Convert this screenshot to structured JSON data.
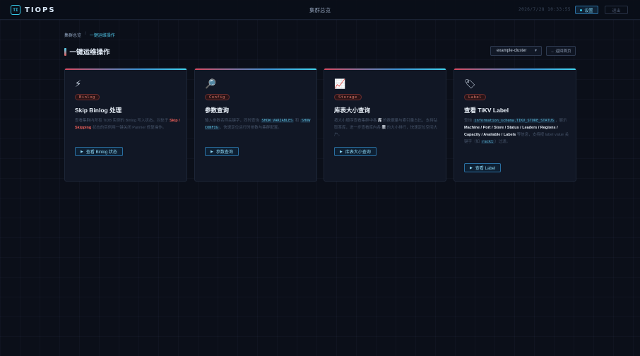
{
  "header": {
    "brand_logo": "TI",
    "brand_name": "TIOPS",
    "center_title": "集群总览",
    "timestamp": "2026/7/28 10:33:55",
    "settings_label": "设置",
    "logout_label": "退出"
  },
  "breadcrumb": {
    "home": "集群总览",
    "separator": "/",
    "current": "一键运维操作"
  },
  "page": {
    "title": "一键运维操作",
    "cluster_select": "example-cluster",
    "back_label": "← 返回首页"
  },
  "cards": [
    {
      "icon": "⚡",
      "icon_name": "lightning-icon",
      "tag": "Binlog",
      "title": "Skip Binlog 处理",
      "desc": [
        {
          "t": "查看集群内所有 TiDB 实例的 Binlog 写入状态。对处于 "
        },
        {
          "t": "Skip / Skipping",
          "s": "red"
        },
        {
          "t": " 状态的实例用一键关闭 Pannier 修复操作。"
        }
      ],
      "button": "查看 Binlog 状态"
    },
    {
      "icon": "🔎",
      "icon_name": "magnifier-icon",
      "tag": "Config",
      "title": "参数查询",
      "desc": [
        {
          "t": "输入参数名称关键字，同时查询 "
        },
        {
          "t": "SHOW VARIABLES",
          "s": "code"
        },
        {
          "t": " 和 "
        },
        {
          "t": "SHOW CONFIG",
          "s": "code"
        },
        {
          "t": "，快速定位运行时参数与集群配置。"
        }
      ],
      "button": "参数查询"
    },
    {
      "icon": "📈",
      "icon_name": "chart-icon",
      "tag": "Storage",
      "title": "库表大小查询",
      "desc": [
        {
          "t": "按大小顺序查看集群中各 "
        },
        {
          "t": "库",
          "s": "white"
        },
        {
          "t": " 的数据量与索引量占比，支持钻取某库，进一步查看库内各 "
        },
        {
          "t": "表",
          "s": "white"
        },
        {
          "t": " 的大小排行，快速定位空间大户。"
        }
      ],
      "button": "库表大小查询"
    },
    {
      "icon": "🏷",
      "icon_name": "label-tag-icon",
      "tag": "Label",
      "title": "查看 TiKV Label",
      "desc": [
        {
          "t": "查询 "
        },
        {
          "t": "information_schema.TIKV_STORE_STATUS",
          "s": "code"
        },
        {
          "t": "，展示 "
        },
        {
          "t": "Machine / Port / Store / Status / Leaders / Regions / Capacity / Available / Labels",
          "s": "white"
        },
        {
          "t": " 等信息，支持按 label value 关键字（如 "
        },
        {
          "t": "rack1",
          "s": "code"
        },
        {
          "t": "）过滤。"
        }
      ],
      "button": "查看 Label"
    }
  ]
}
